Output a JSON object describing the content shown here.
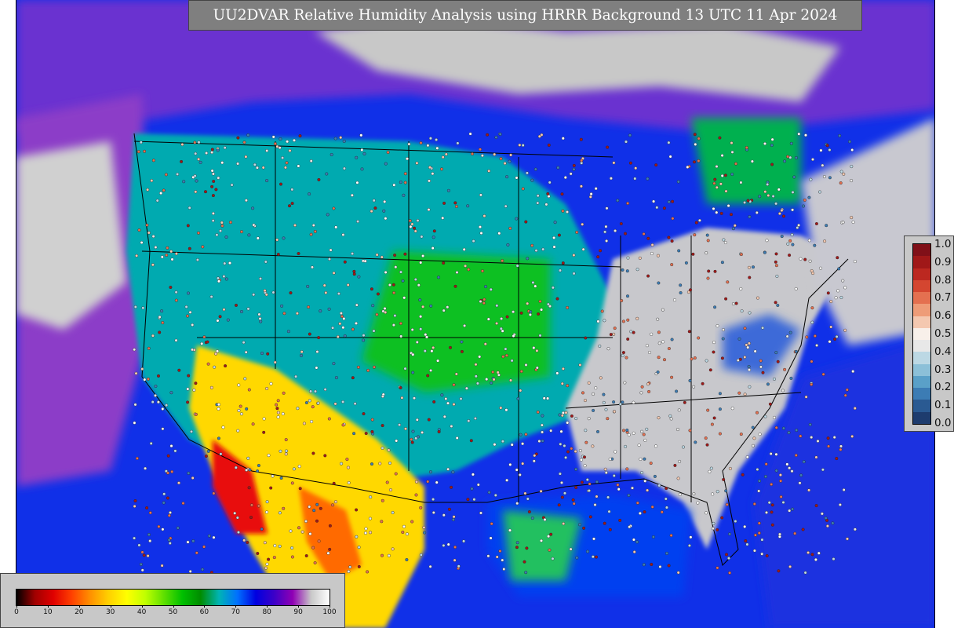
{
  "title": "UU2DVAR Relative Humidity Analysis using HRRR Background 13 UTC 11 Apr 2024",
  "rh_legend": {
    "ticks": [
      "0",
      "10",
      "20",
      "30",
      "40",
      "50",
      "60",
      "70",
      "80",
      "90",
      "100"
    ],
    "colors": [
      "#000000",
      "#a00000",
      "#e00000",
      "#ff4000",
      "#ff9000",
      "#ffd000",
      "#ffff00",
      "#c0ff00",
      "#60e000",
      "#00c000",
      "#008c00",
      "#00b4b4",
      "#0070ff",
      "#0000e0",
      "#3c00c8",
      "#9000b4",
      "#c8c8c8",
      "#ffffff"
    ]
  },
  "obs_legend": {
    "ticks": [
      "0.0",
      "0.1",
      "0.2",
      "0.3",
      "0.4",
      "0.5",
      "0.6",
      "0.7",
      "0.8",
      "0.9",
      "1.0"
    ],
    "colors": [
      "#1e3c6e",
      "#2a5a92",
      "#3c7cb4",
      "#5aa0c8",
      "#8cc0d8",
      "#bcd8e4",
      "#e8e8e8",
      "#f8f0ea",
      "#f4c8b0",
      "#ee9c78",
      "#e47050",
      "#d44630",
      "#bc2820",
      "#a01818",
      "#801018"
    ]
  },
  "map": {
    "background": "#c8c8c8",
    "ocean": "#0a28e6",
    "land_east": "#c8c8c8",
    "land_west": "#00b0b0",
    "land_sw": "#ffd000"
  }
}
